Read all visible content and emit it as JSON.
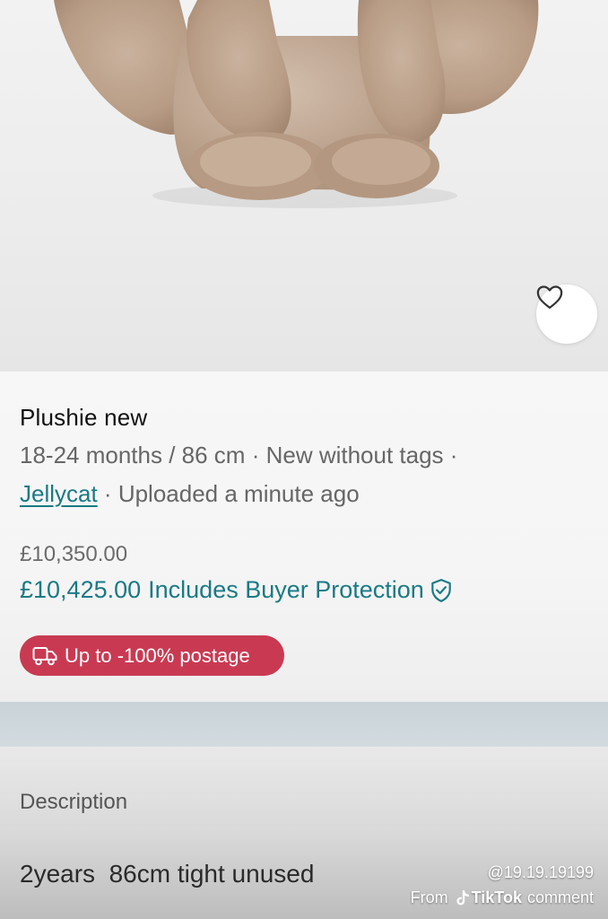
{
  "listing": {
    "title": "Plushie new",
    "size": "18-24 months / 86 cm",
    "separator": " · ",
    "condition": "New without tags",
    "brand": "Jellycat",
    "uploaded": "Uploaded a minute ago",
    "price_original": "£10,350.00",
    "price_total": "£10,425.00",
    "buyer_protection_label": "Includes Buyer Protection",
    "postage_badge": "Up to -100% postage"
  },
  "description": {
    "label": "Description",
    "text": "2years  86cm tight unused"
  },
  "watermark": {
    "username": "@19.19.19199",
    "from": "From",
    "app_name": "TikTok",
    "suffix": "comment"
  },
  "colors": {
    "accent_teal": "#1a7a85",
    "postage_badge_bg": "#c93a52"
  },
  "icons": {
    "favorite": "heart-icon",
    "protection": "shield-check-icon",
    "postage": "truck-icon",
    "watermark": "tiktok-logo-icon"
  }
}
